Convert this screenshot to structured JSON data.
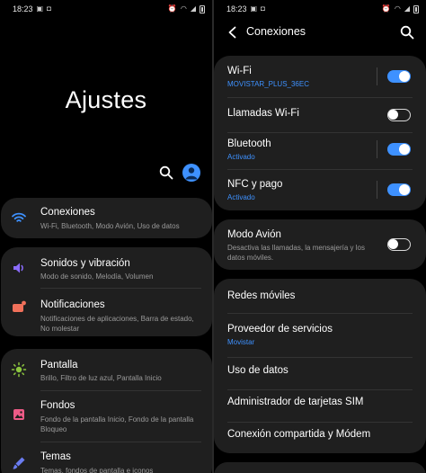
{
  "left_screen": {
    "status_bar": {
      "time": "18:23"
    },
    "title": "Ajustes",
    "settings": [
      {
        "title": "Conexiones",
        "subtitle": "Wi-Fi, Bluetooth, Modo Avión, Uso de datos",
        "icon": "wifi-icon",
        "color": "#3e91ff"
      },
      {
        "title": "Sonidos y vibración",
        "subtitle": "Modo de sonido, Melodía, Volumen",
        "icon": "speaker-icon",
        "color": "#8b6cff"
      },
      {
        "title": "Notificaciones",
        "subtitle": "Notificaciones de aplicaciones, Barra de estado, No molestar",
        "icon": "notification-icon",
        "color": "#f0705a"
      },
      {
        "title": "Pantalla",
        "subtitle": "Brillo, Filtro de luz azul, Pantalla Inicio",
        "icon": "sun-icon",
        "color": "#8cc63f"
      },
      {
        "title": "Fondos",
        "subtitle": "Fondo de la pantalla Inicio, Fondo de la pantalla Bloqueo",
        "icon": "image-icon",
        "color": "#ec5a86"
      },
      {
        "title": "Temas",
        "subtitle": "Temas, fondos de pantalla e iconos",
        "icon": "brush-icon",
        "color": "#6a7cf0"
      }
    ]
  },
  "right_screen": {
    "status_bar": {
      "time": "18:23"
    },
    "header": {
      "title": "Conexiones"
    },
    "wifi": {
      "title": "Wi-Fi",
      "subtitle": "MOVISTAR_PLUS_36EC",
      "enabled": true
    },
    "wifi_calling": {
      "title": "Llamadas Wi-Fi",
      "enabled": false
    },
    "bluetooth": {
      "title": "Bluetooth",
      "subtitle": "Activado",
      "enabled": true
    },
    "nfc": {
      "title": "NFC y pago",
      "subtitle": "Activado",
      "enabled": true
    },
    "airplane": {
      "title": "Modo Avión",
      "description": "Desactiva las llamadas, la mensajería y los datos móviles.",
      "enabled": false
    },
    "menu": [
      {
        "title": "Redes móviles"
      },
      {
        "title": "Proveedor de servicios",
        "subtitle": "Movistar"
      },
      {
        "title": "Uso de datos"
      },
      {
        "title": "Administrador de tarjetas SIM"
      },
      {
        "title": "Conexión compartida y Módem"
      }
    ],
    "accent_color": "#3e91ff"
  }
}
